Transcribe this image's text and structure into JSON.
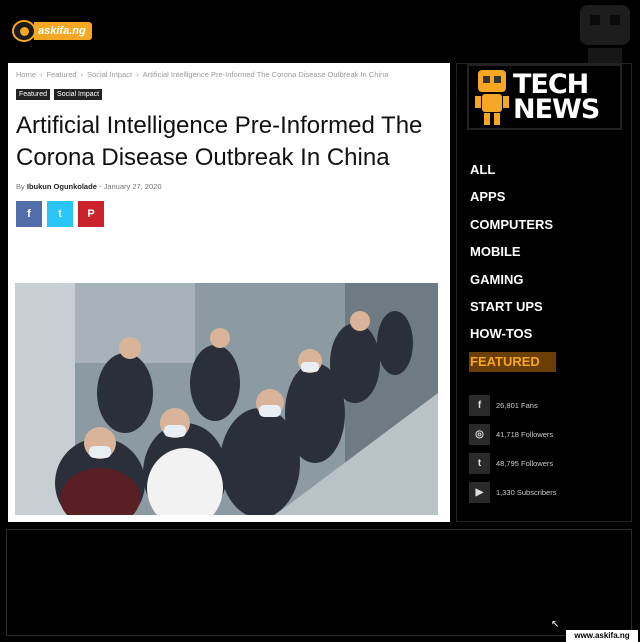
{
  "site": {
    "logo_text": "askifa.ng"
  },
  "breadcrumb": {
    "items": [
      "Home",
      "Featured",
      "Social Impact",
      "Artificial Intelligence Pre-Informed The Corona Disease Outbreak In China"
    ],
    "separator": "›"
  },
  "tags": [
    "Featured",
    "Social Impact"
  ],
  "article": {
    "title": "Artificial Intelligence Pre-Informed The Corona Disease Outbreak In China",
    "by_label": "By",
    "author": "Ibukun Ogunkolade",
    "date_sep": "-",
    "date": "January 27, 2020",
    "share_icons": [
      "facebook-icon",
      "twitter-icon",
      "pinterest-icon"
    ]
  },
  "share": {
    "facebook_glyph": "f",
    "twitter_glyph": "t",
    "pinterest_glyph": "P"
  },
  "sidebar": {
    "banner_line1": "TECH",
    "banner_line2": "NEWS",
    "menu": [
      "ALL",
      "APPS",
      "COMPUTERS",
      "MOBILE",
      "GAMING",
      "START UPS",
      "HOW-TOS",
      "FEATURED"
    ],
    "active_menu": "FEATURED",
    "social": [
      {
        "icon": "facebook-icon",
        "glyph": "f",
        "text": "26,801 Fans"
      },
      {
        "icon": "instagram-icon",
        "glyph": "◎",
        "text": "41,718 Followers"
      },
      {
        "icon": "twitter-icon",
        "glyph": "t",
        "text": "48,795 Followers"
      },
      {
        "icon": "youtube-icon",
        "glyph": "▶",
        "text": "1,330 Subscribers"
      }
    ]
  },
  "footer": {
    "watermark": "www.askifa.ng"
  },
  "colors": {
    "accent": "#f5a623",
    "facebook": "#516eab",
    "twitter": "#29c5f6",
    "pinterest": "#ca212a"
  }
}
